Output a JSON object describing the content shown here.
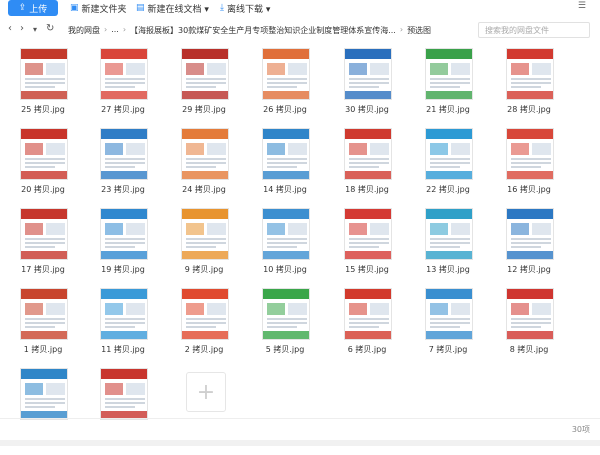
{
  "toolbar": {
    "upload_label": "上传",
    "new_folder_label": "新建文件夹",
    "new_doc_label": "新建在线文档 ▾",
    "offline_download_label": "离线下载 ▾"
  },
  "nav": {
    "back_icon": "back-arrow-icon",
    "forward_icon": "forward-arrow-icon",
    "dropdown_icon": "chevron-down-icon",
    "refresh_icon": "refresh-icon"
  },
  "breadcrumb": [
    "我的网盘",
    "...",
    "【海报展板】30款煤矿安全生产月专项整治知识企业制度管理体系宣传海...",
    "预选图"
  ],
  "search": {
    "placeholder": "搜索我的网盘文件"
  },
  "files": [
    {
      "name": "25 拷贝.jpg",
      "accent": "#c33a2b"
    },
    {
      "name": "27 拷贝.jpg",
      "accent": "#d9453a"
    },
    {
      "name": "29 拷贝.jpg",
      "accent": "#b8302a"
    },
    {
      "name": "26 拷贝.jpg",
      "accent": "#e06f3a"
    },
    {
      "name": "30 拷贝.jpg",
      "accent": "#2a6fbd"
    },
    {
      "name": "21 拷贝.jpg",
      "accent": "#3aa14a"
    },
    {
      "name": "28 拷贝.jpg",
      "accent": "#d23a30"
    },
    {
      "name": "20 拷贝.jpg",
      "accent": "#c8342a"
    },
    {
      "name": "23 拷贝.jpg",
      "accent": "#2f7dc6"
    },
    {
      "name": "24 拷贝.jpg",
      "accent": "#e47b3a"
    },
    {
      "name": "14 拷贝.jpg",
      "accent": "#2f85c9"
    },
    {
      "name": "18 拷贝.jpg",
      "accent": "#cf3a2f"
    },
    {
      "name": "22 拷贝.jpg",
      "accent": "#2d9ad4"
    },
    {
      "name": "16 拷贝.jpg",
      "accent": "#d8473a"
    },
    {
      "name": "17 拷贝.jpg",
      "accent": "#c6362c"
    },
    {
      "name": "19 拷贝.jpg",
      "accent": "#2f88cf"
    },
    {
      "name": "9 拷贝.jpg",
      "accent": "#e8942f"
    },
    {
      "name": "10 拷贝.jpg",
      "accent": "#3c8fd0"
    },
    {
      "name": "15 拷贝.jpg",
      "accent": "#d43a34"
    },
    {
      "name": "13 拷贝.jpg",
      "accent": "#2fa0c8"
    },
    {
      "name": "12 拷贝.jpg",
      "accent": "#2c78c3"
    },
    {
      "name": "1 拷贝.jpg",
      "accent": "#c8452e"
    },
    {
      "name": "11 拷贝.jpg",
      "accent": "#3a9ad8"
    },
    {
      "name": "2 拷贝.jpg",
      "accent": "#e04a2f"
    },
    {
      "name": "5 拷贝.jpg",
      "accent": "#3aa64a"
    },
    {
      "name": "6 拷贝.jpg",
      "accent": "#d23a2c"
    },
    {
      "name": "7 拷贝.jpg",
      "accent": "#3a8fd0"
    },
    {
      "name": "8 拷贝.jpg",
      "accent": "#cf3530"
    },
    {
      "name": "",
      "accent": "#2f86c8"
    },
    {
      "name": "",
      "accent": "#c8352e"
    }
  ],
  "add_tile_icon": "plus-icon",
  "footer": {
    "count": "30项"
  }
}
